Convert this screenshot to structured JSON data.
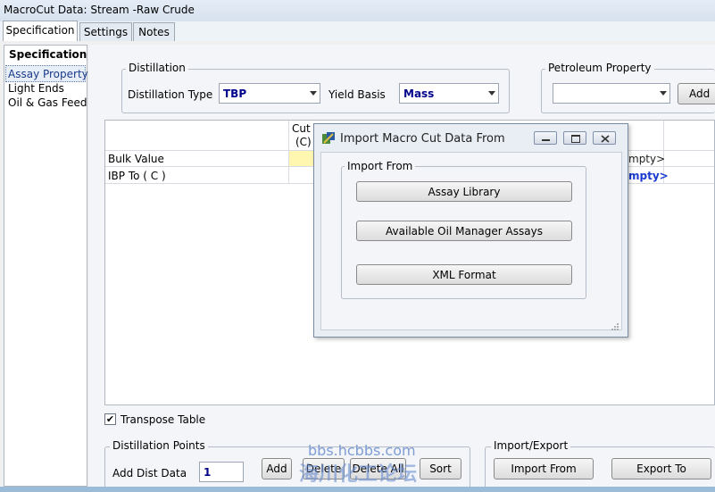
{
  "window": {
    "title": "MacroCut Data: Stream -Raw Crude"
  },
  "tabs": [
    {
      "label": "Specification"
    },
    {
      "label": "Settings"
    },
    {
      "label": "Notes"
    }
  ],
  "sidebar": {
    "title": "Specification",
    "items": [
      {
        "label": "Assay Property"
      },
      {
        "label": "Light Ends"
      },
      {
        "label": "Oil & Gas Feed"
      }
    ]
  },
  "distillation": {
    "group_label": "Distillation",
    "type_label": "Distillation Type",
    "type_value": "TBP",
    "yield_label": "Yield Basis",
    "yield_value": "Mass"
  },
  "petroleum": {
    "group_label": "Petroleum Property",
    "value": "",
    "add_label": "Add"
  },
  "table": {
    "col_header_line1": "Cut",
    "col_header_line2": "(C)",
    "rows": [
      {
        "label": "Bulk Value",
        "right": "mpty>"
      },
      {
        "label": "IBP  To    ( C )",
        "right": "mpty>"
      }
    ]
  },
  "dialog": {
    "title": "Import Macro Cut Data From",
    "group_label": "Import From",
    "buttons": [
      {
        "label": "Assay Library"
      },
      {
        "label": "Available Oil Manager Assays"
      },
      {
        "label": "XML Format"
      }
    ]
  },
  "transpose": {
    "label": "Transpose Table",
    "checked": "✔"
  },
  "dist_points": {
    "group_label": "Distillation Points",
    "add_label": "Add Dist Data",
    "value": "1",
    "add_button": "Add",
    "delete_button": "Delete",
    "delete_all_button": "Delete All",
    "sort_button": "Sort"
  },
  "import_export": {
    "group_label": "Import/Export",
    "import_button": "Import From",
    "export_button": "Export To"
  },
  "watermark": {
    "line1": "bbs.hcbbs.com",
    "line2": "海川化工论坛"
  }
}
